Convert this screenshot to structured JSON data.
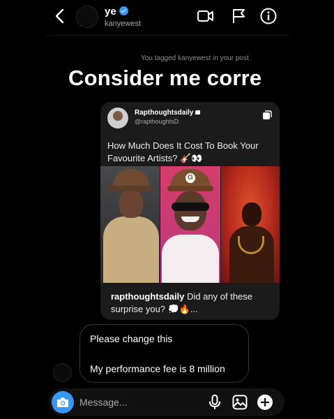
{
  "header": {
    "name": "ye",
    "username": "kanyewest",
    "verified": true,
    "icons": [
      "back-icon",
      "video-call-icon",
      "flag-icon",
      "info-icon"
    ]
  },
  "tagged_notice": "You tagged kanyewest in your post",
  "caption_overlay": "Consider me corre",
  "shared_post": {
    "account_name": "Rapthoughtsdaily",
    "account_handle": "@rapthoughtsD",
    "text": "How Much Does It Cost To Book Your Favourite Artists? 🎸👀",
    "photo_logo_letter": "G",
    "caption_user": "rapthoughtsdaily",
    "caption_text": " Did any of these surprise you? 💭🔥..."
  },
  "messages": [
    {
      "text": "Please change this"
    },
    {
      "text": "My performance fee is 8 million"
    }
  ],
  "composer": {
    "placeholder": "Message..."
  },
  "colors": {
    "background": "#000000",
    "accent": "#3897f0",
    "bubble_border": "#363636",
    "post_card": "#1b1b1b"
  }
}
